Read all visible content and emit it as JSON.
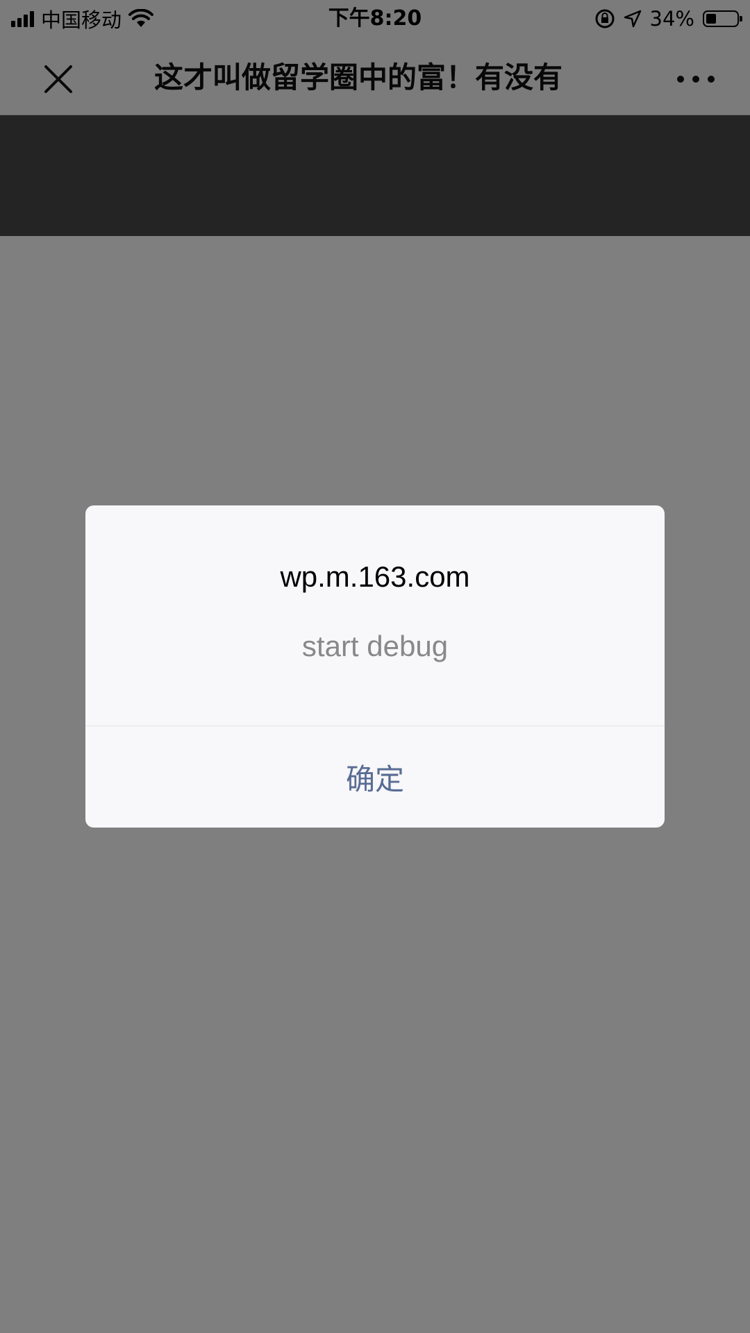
{
  "status_bar": {
    "carrier": "中国移动",
    "time": "下午8:20",
    "battery_percent": "34%",
    "battery_level": 0.34,
    "icons": [
      "signal-icon",
      "wifi-icon",
      "orientation-lock-icon",
      "location-arrow-icon",
      "battery-icon"
    ]
  },
  "nav": {
    "title": "这才叫做留学圈中的富！有没有",
    "close_icon": "close-icon",
    "more_icon": "more-icon"
  },
  "dialog": {
    "title": "wp.m.163.com",
    "message": "start debug",
    "confirm_label": "确定",
    "button_color": "#586c94"
  },
  "colors": {
    "overlay": "rgba(0,0,0,0.5)",
    "dialog_bg": "#f8f7f9",
    "banner": "#494949"
  }
}
